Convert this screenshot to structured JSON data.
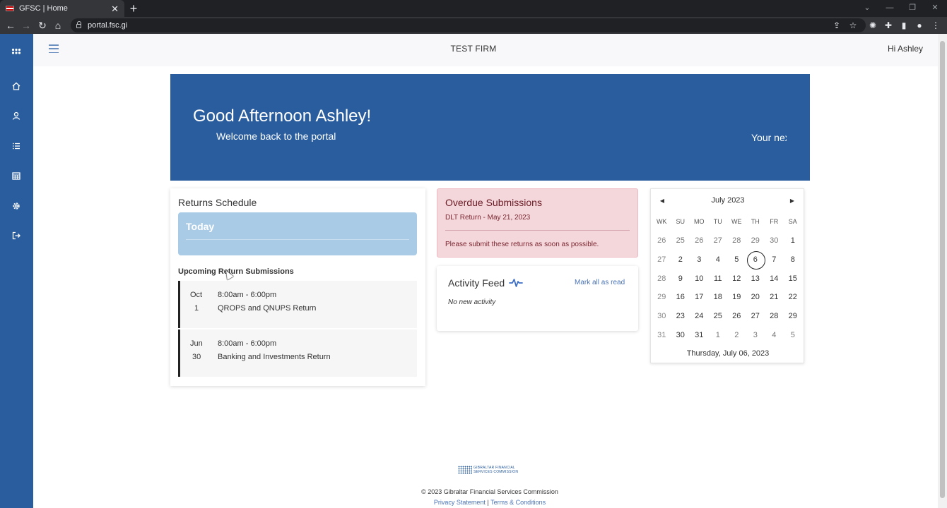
{
  "browser": {
    "tab_title": "GFSC | Home",
    "tab_close": "✕",
    "new_tab": "+",
    "url": "portal.fsc.gi"
  },
  "header": {
    "firm_name": "TEST FIRM",
    "greeting": "Hi Ashley"
  },
  "sidebar": {
    "items": [
      "apps-icon",
      "home-icon",
      "user-icon",
      "list-icon",
      "calendar-icon",
      "gear-icon",
      "logout-icon"
    ]
  },
  "hero": {
    "title": "Good Afternoon Ashley!",
    "subtitle": "Welcome back to the portal",
    "ticker": "Your nex"
  },
  "returns": {
    "title": "Returns Schedule",
    "today_label": "Today",
    "upcoming_title": "Upcoming Return Submissions",
    "items": [
      {
        "month": "Oct",
        "day": "1",
        "time": "8:00am - 6:00pm",
        "name": "QROPS and QNUPS Return"
      },
      {
        "month": "Jun",
        "day": "30",
        "time": "8:00am - 6:00pm",
        "name": "Banking and Investments Return"
      }
    ]
  },
  "overdue": {
    "title": "Overdue Submissions",
    "item": "DLT Return - May 21, 2023",
    "message": "Please submit these returns as soon as possible."
  },
  "activity": {
    "title": "Activity Feed",
    "mark_read": "Mark all as read",
    "empty": "No new activity"
  },
  "calendar": {
    "month_label": "July 2023",
    "prev": "◀",
    "next": "▶",
    "headers": [
      "WK",
      "SU",
      "MO",
      "TU",
      "WE",
      "TH",
      "FR",
      "SA"
    ],
    "weeks": [
      [
        "26",
        "25",
        "26",
        "27",
        "28",
        "29",
        "30",
        "1"
      ],
      [
        "27",
        "2",
        "3",
        "4",
        "5",
        "6",
        "7",
        "8"
      ],
      [
        "28",
        "9",
        "10",
        "11",
        "12",
        "13",
        "14",
        "15"
      ],
      [
        "29",
        "16",
        "17",
        "18",
        "19",
        "20",
        "21",
        "22"
      ],
      [
        "30",
        "23",
        "24",
        "25",
        "26",
        "27",
        "28",
        "29"
      ],
      [
        "31",
        "30",
        "31",
        "1",
        "2",
        "3",
        "4",
        "5"
      ]
    ],
    "selected": "6",
    "footer": "Thursday, July 06, 2023"
  },
  "footer": {
    "logo_line1": "GIBRALTAR FINANCIAL",
    "logo_line2": "SERVICES COMMISSION",
    "copyright": "© 2023 Gibraltar Financial Services Commission",
    "privacy": "Privacy Statement",
    "separator": "|",
    "terms": "Terms & Conditions"
  },
  "colors": {
    "brand_blue": "#2a5d9d",
    "today_blue": "#a9cbe6",
    "overdue_bg": "#f4d7db",
    "link": "#4a73b4"
  }
}
